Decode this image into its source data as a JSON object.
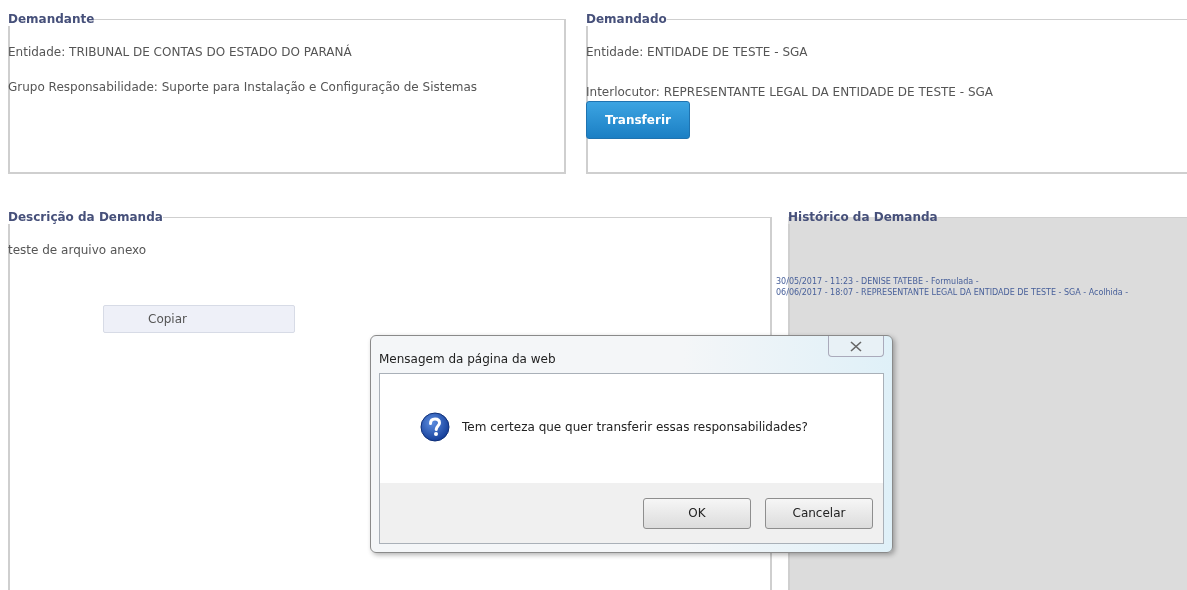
{
  "demandante": {
    "title": "Demandante",
    "lines": [
      "Entidade: TRIBUNAL DE CONTAS DO ESTADO DO PARANÁ",
      "Grupo Responsabilidade: Suporte para Instalação e Configuração de Sistemas"
    ]
  },
  "demandado": {
    "title": "Demandado",
    "lines": [
      "Entidade: ENTIDADE DE TESTE - SGA",
      "Interlocutor: REPRESENTANTE LEGAL DA ENTIDADE DE TESTE - SGA"
    ],
    "button": "Transferir"
  },
  "descricao": {
    "title": "Descrição da Demanda",
    "text": "teste de arquivo anexo",
    "button": "Copiar"
  },
  "historico": {
    "title": "Histórico da Demanda",
    "entries": [
      "30/05/2017 - 11:23 - DENISE TATEBE - Formulada -",
      "06/06/2017 - 18:07 - REPRESENTANTE LEGAL DA ENTIDADE DE TESTE - SGA - Acolhida -"
    ]
  },
  "dialog": {
    "title": "Mensagem da página da web",
    "message": "Tem certeza que quer transferir essas responsabilidades?",
    "buttons": [
      "OK",
      "Cancelar"
    ]
  }
}
